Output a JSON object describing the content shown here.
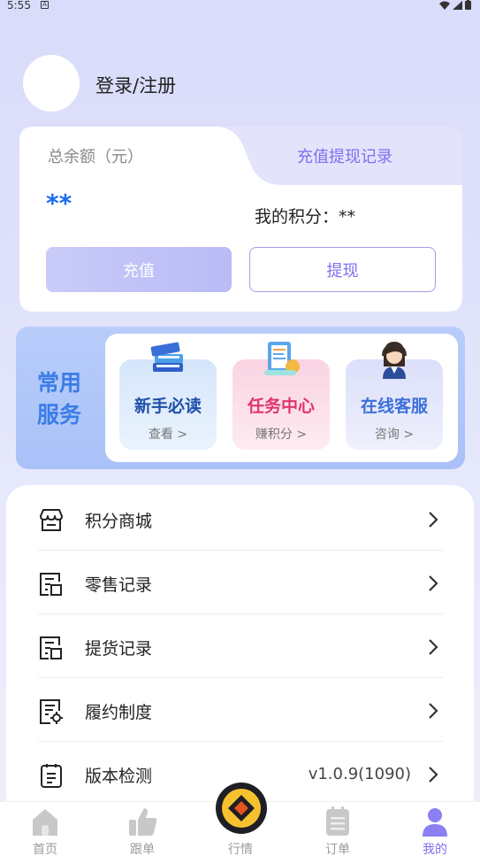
{
  "status_bar": {
    "time": "5:55",
    "notif": "A"
  },
  "profile": {
    "login_text": "登录/注册"
  },
  "balance": {
    "label": "总余额（元）",
    "record_tab": "充值提现记录",
    "amount": "**",
    "points": "我的积分：**",
    "charge_label": "充值",
    "withdraw_label": "提现"
  },
  "services": {
    "title": "常用服务",
    "items": [
      {
        "title": "新手必读",
        "sub": "查看 >",
        "icon": "books-icon",
        "color": "#1f4fa8",
        "bg": "#d9e9fb"
      },
      {
        "title": "任务中心",
        "sub": "赚积分 >",
        "icon": "task-clipboard-icon",
        "color": "#e0356d",
        "bg": "#fbe1ec"
      },
      {
        "title": "在线客服",
        "sub": "咨询 >",
        "icon": "customer-service-icon",
        "color": "#3b6fd8",
        "bg": "#e4e8fb"
      }
    ]
  },
  "menu": [
    {
      "label": "积分商城",
      "icon": "store-icon",
      "value": ""
    },
    {
      "label": "零售记录",
      "icon": "receipt-icon",
      "value": ""
    },
    {
      "label": "提货记录",
      "icon": "receipt-icon",
      "value": ""
    },
    {
      "label": "履约制度",
      "icon": "policy-doc-icon",
      "value": ""
    },
    {
      "label": "版本检测",
      "icon": "clipboard-icon",
      "value": "v1.0.9(1090)"
    }
  ],
  "nav": [
    {
      "label": "首页",
      "icon": "home-icon",
      "active": false
    },
    {
      "label": "跟单",
      "icon": "thumbs-up-icon",
      "active": false
    },
    {
      "label": "行情",
      "icon": "market-icon",
      "active": false
    },
    {
      "label": "订单",
      "icon": "order-icon",
      "active": false
    },
    {
      "label": "我的",
      "icon": "user-icon",
      "active": true
    }
  ],
  "colors": {
    "accent": "#7c6ff0",
    "amount": "#1a6bf0",
    "services_title": "#3b7de8"
  }
}
